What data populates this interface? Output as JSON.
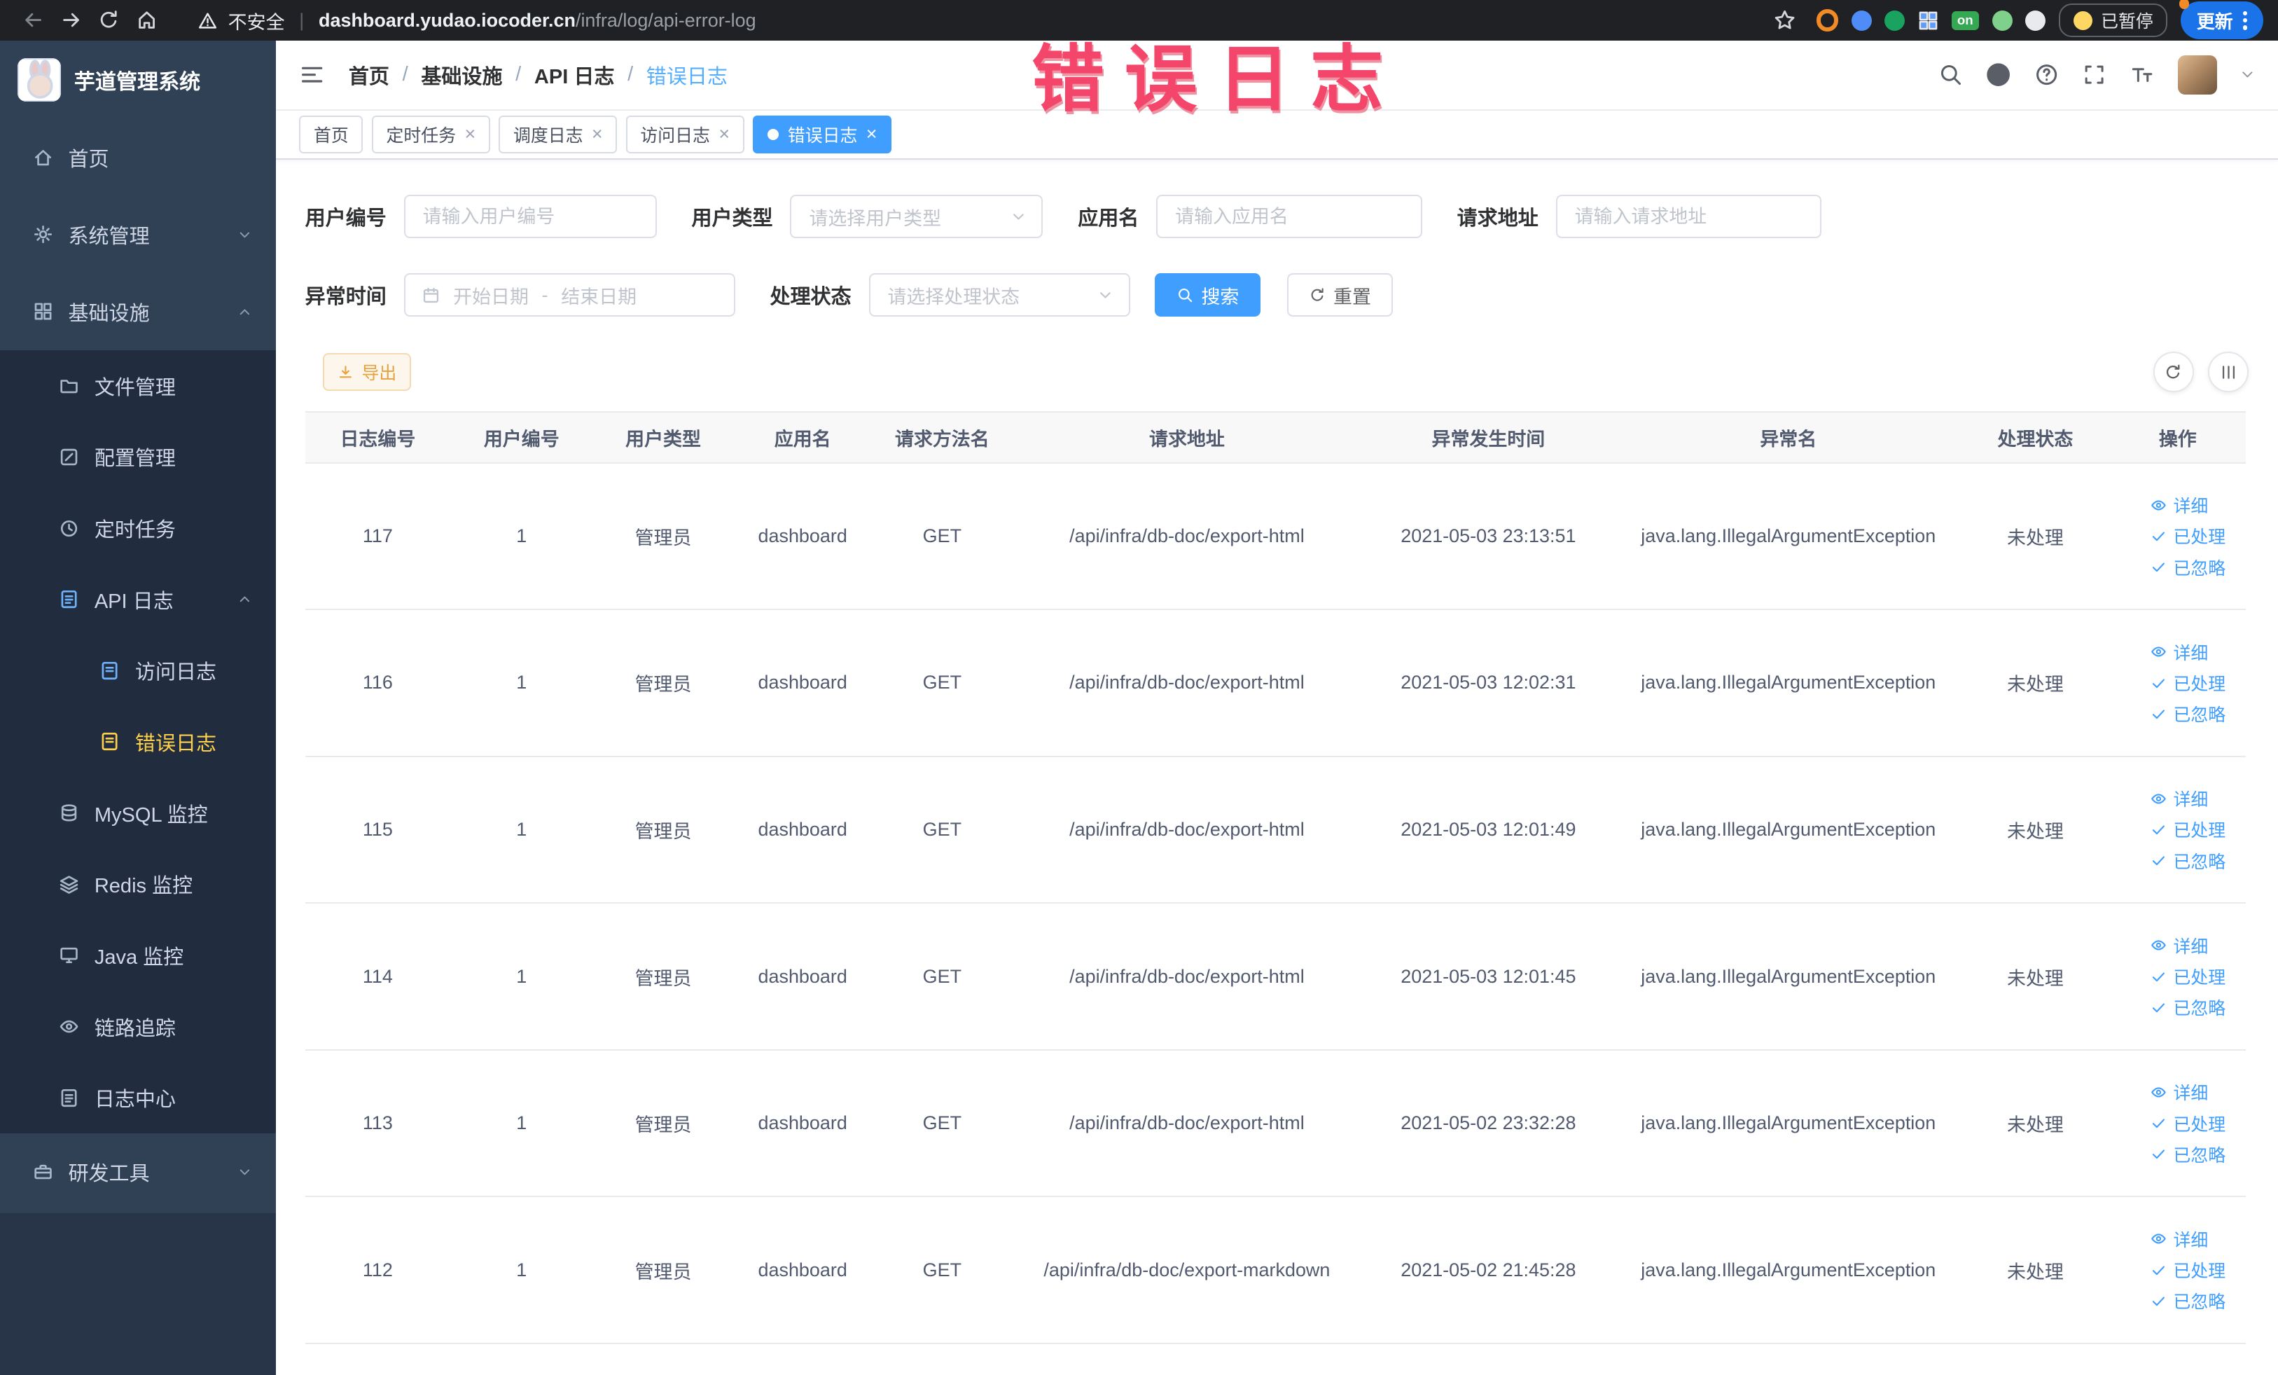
{
  "watermark": "错误日志",
  "browser": {
    "security_label": "不安全",
    "url_domain": "dashboard.yudao.iocoder.cn",
    "url_path": "/infra/log/api-error-log",
    "extension_on_badge": "on",
    "paused_badge": "已暂停",
    "update_button": "更新"
  },
  "sidebar": {
    "app_title": "芋道管理系统",
    "items": [
      {
        "label": "首页"
      },
      {
        "label": "系统管理"
      },
      {
        "label": "基础设施"
      },
      {
        "label": "文件管理"
      },
      {
        "label": "配置管理"
      },
      {
        "label": "定时任务"
      },
      {
        "label": "API 日志"
      },
      {
        "label": "访问日志"
      },
      {
        "label": "错误日志"
      },
      {
        "label": "MySQL 监控"
      },
      {
        "label": "Redis 监控"
      },
      {
        "label": "Java 监控"
      },
      {
        "label": "链路追踪"
      },
      {
        "label": "日志中心"
      },
      {
        "label": "研发工具"
      }
    ]
  },
  "breadcrumb": [
    "首页",
    "基础设施",
    "API 日志",
    "错误日志"
  ],
  "tabs": [
    {
      "label": "首页"
    },
    {
      "label": "定时任务"
    },
    {
      "label": "调度日志"
    },
    {
      "label": "访问日志"
    },
    {
      "label": "错误日志"
    }
  ],
  "filters": {
    "user_id_label": "用户编号",
    "user_id_placeholder": "请输入用户编号",
    "user_type_label": "用户类型",
    "user_type_placeholder": "请选择用户类型",
    "app_name_label": "应用名",
    "app_name_placeholder": "请输入应用名",
    "request_url_label": "请求地址",
    "request_url_placeholder": "请输入请求地址",
    "exception_time_label": "异常时间",
    "date_start_placeholder": "开始日期",
    "date_separator": "-",
    "date_end_placeholder": "结束日期",
    "process_status_label": "处理状态",
    "process_status_placeholder": "请选择处理状态",
    "search_button": "搜索",
    "reset_button": "重置"
  },
  "toolbar": {
    "export_button": "导出"
  },
  "table": {
    "columns": [
      "日志编号",
      "用户编号",
      "用户类型",
      "应用名",
      "请求方法名",
      "请求地址",
      "异常发生时间",
      "异常名",
      "处理状态",
      "操作"
    ],
    "actions": {
      "detail": "详细",
      "processed": "已处理",
      "ignored": "已忽略"
    },
    "rows": [
      {
        "id": "117",
        "user_id": "1",
        "user_type": "管理员",
        "app_name": "dashboard",
        "method": "GET",
        "url": "/api/infra/db-doc/export-html",
        "time": "2021-05-03 23:13:51",
        "exception": "java.lang.IllegalArgumentException",
        "status": "未处理"
      },
      {
        "id": "116",
        "user_id": "1",
        "user_type": "管理员",
        "app_name": "dashboard",
        "method": "GET",
        "url": "/api/infra/db-doc/export-html",
        "time": "2021-05-03 12:02:31",
        "exception": "java.lang.IllegalArgumentException",
        "status": "未处理"
      },
      {
        "id": "115",
        "user_id": "1",
        "user_type": "管理员",
        "app_name": "dashboard",
        "method": "GET",
        "url": "/api/infra/db-doc/export-html",
        "time": "2021-05-03 12:01:49",
        "exception": "java.lang.IllegalArgumentException",
        "status": "未处理"
      },
      {
        "id": "114",
        "user_id": "1",
        "user_type": "管理员",
        "app_name": "dashboard",
        "method": "GET",
        "url": "/api/infra/db-doc/export-html",
        "time": "2021-05-03 12:01:45",
        "exception": "java.lang.IllegalArgumentException",
        "status": "未处理"
      },
      {
        "id": "113",
        "user_id": "1",
        "user_type": "管理员",
        "app_name": "dashboard",
        "method": "GET",
        "url": "/api/infra/db-doc/export-html",
        "time": "2021-05-02 23:32:28",
        "exception": "java.lang.IllegalArgumentException",
        "status": "未处理"
      },
      {
        "id": "112",
        "user_id": "1",
        "user_type": "管理员",
        "app_name": "dashboard",
        "method": "GET",
        "url": "/api/infra/db-doc/export-markdown",
        "time": "2021-05-02 21:45:28",
        "exception": "java.lang.IllegalArgumentException",
        "status": "未处理"
      }
    ]
  },
  "colors": {
    "primary": "#409eff",
    "sidebar_bg": "#304156",
    "sidebar_submenu_bg": "#212d3e",
    "sidebar_active_text": "#ffd04b",
    "warning_button": "#e6a23c",
    "watermark": "#f4466b"
  }
}
